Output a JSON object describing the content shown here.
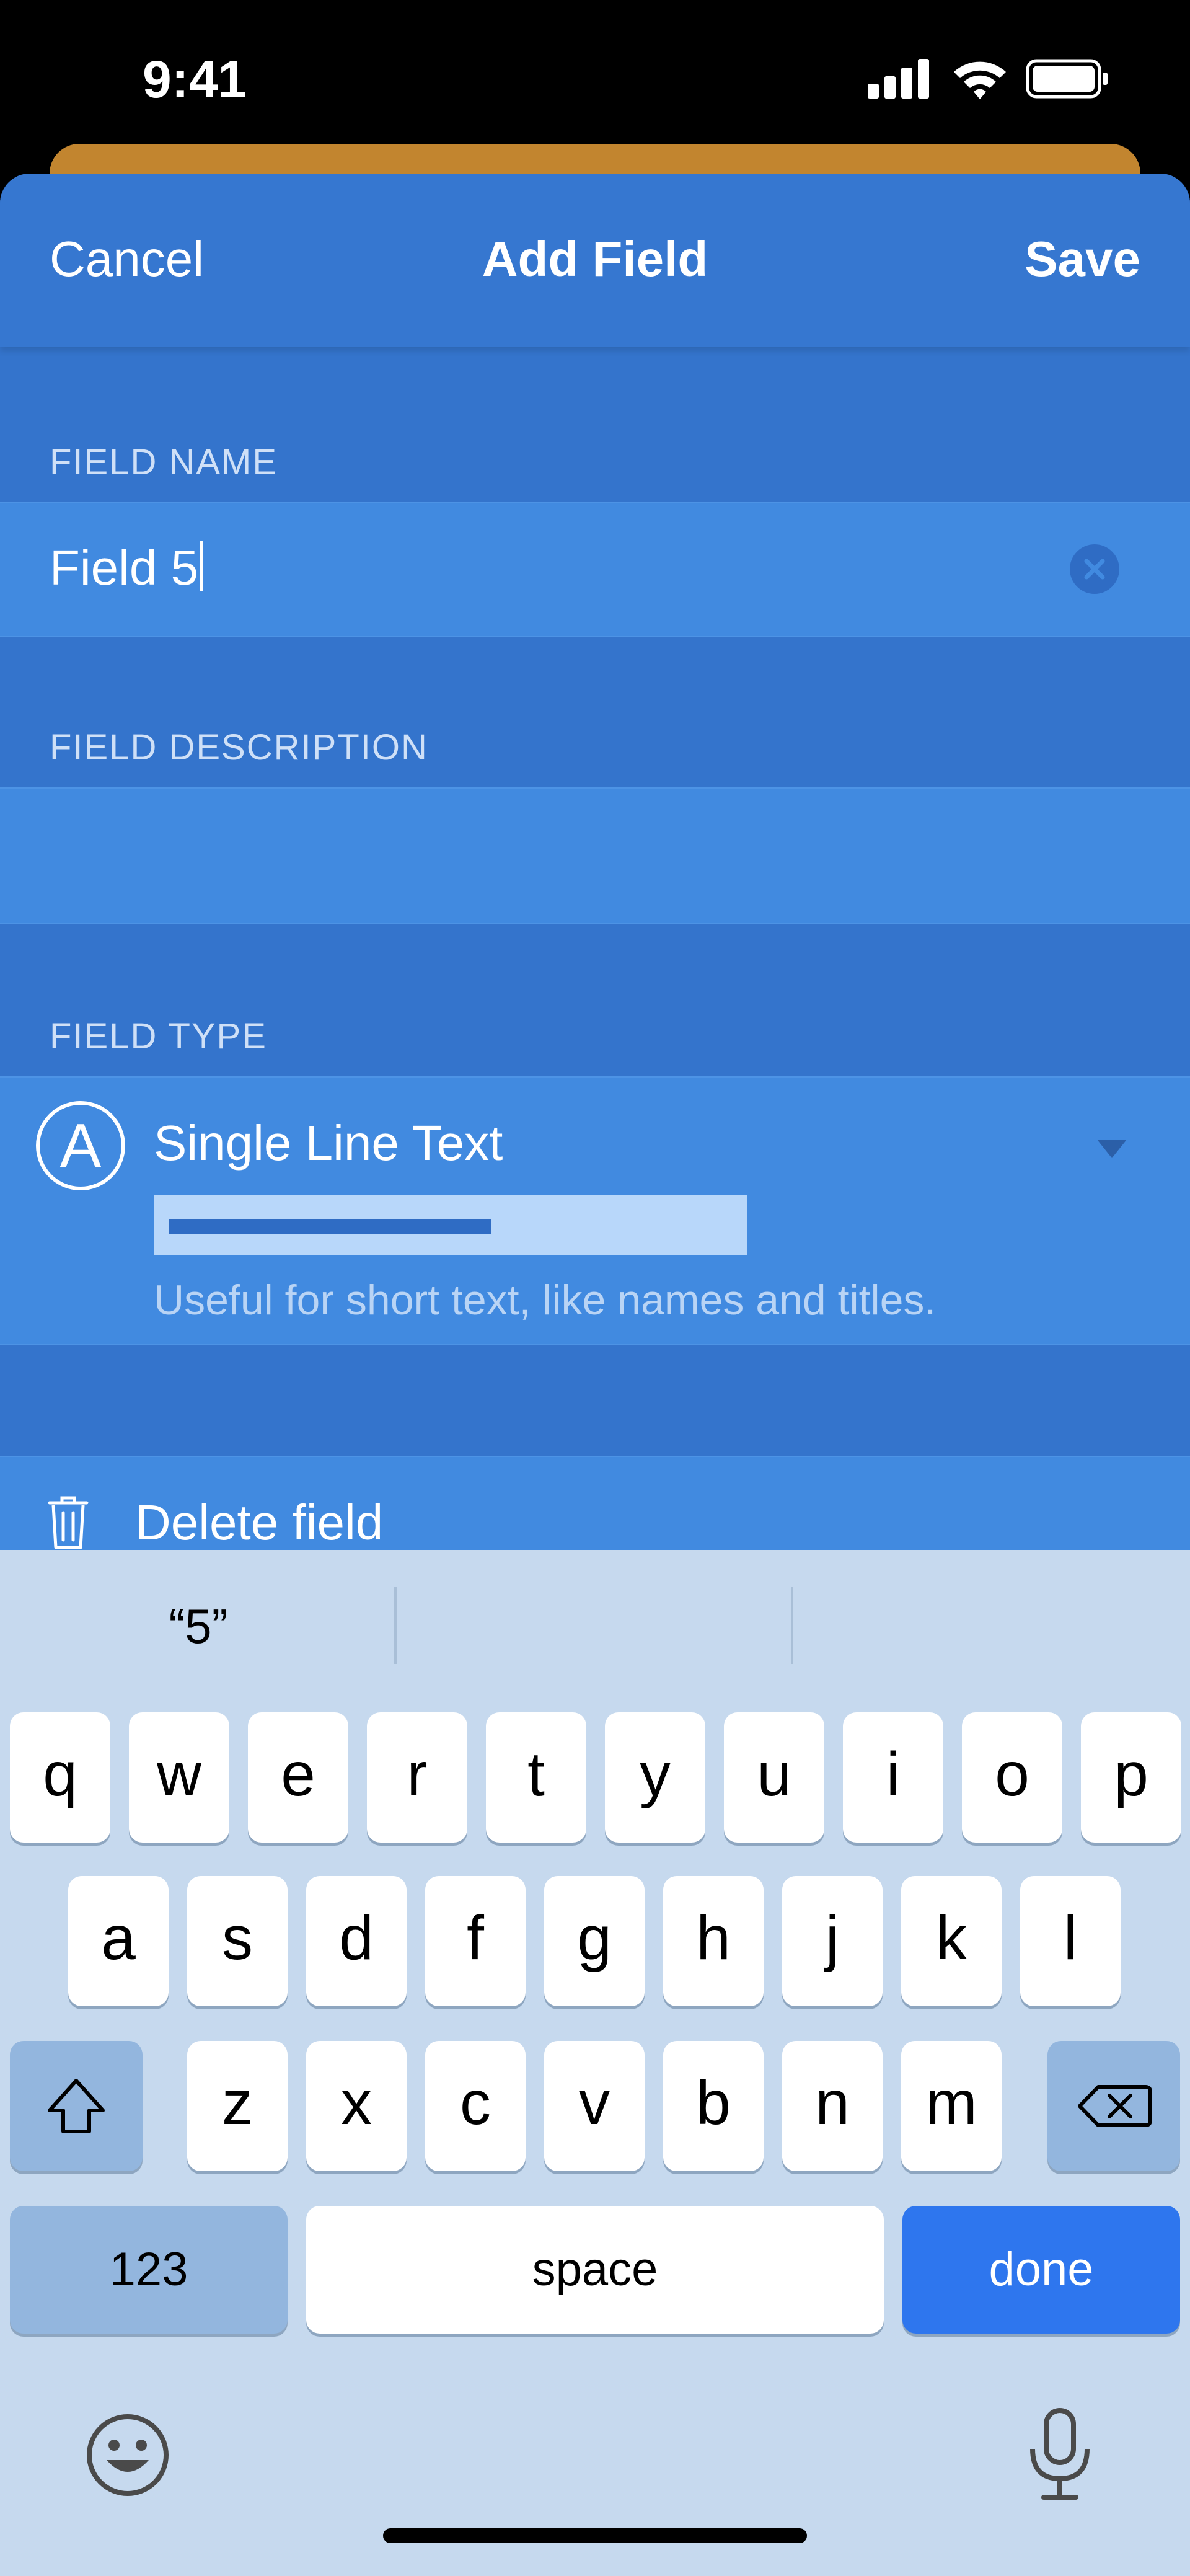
{
  "status_bar": {
    "time": "9:41"
  },
  "navbar": {
    "cancel": "Cancel",
    "title": "Add Field",
    "save": "Save"
  },
  "sections": {
    "field_name": {
      "label": "FIELD NAME",
      "value": "Field 5"
    },
    "field_description": {
      "label": "FIELD DESCRIPTION",
      "value": ""
    },
    "field_type": {
      "label": "FIELD TYPE",
      "icon_letter": "A",
      "type_name": "Single Line Text",
      "description": "Useful for short text, like names and titles."
    }
  },
  "delete": {
    "label": "Delete field"
  },
  "keyboard": {
    "suggestions": [
      "“5”",
      "",
      ""
    ],
    "row1": [
      "q",
      "w",
      "e",
      "r",
      "t",
      "y",
      "u",
      "i",
      "o",
      "p"
    ],
    "row2": [
      "a",
      "s",
      "d",
      "f",
      "g",
      "h",
      "j",
      "k",
      "l"
    ],
    "row3": [
      "z",
      "x",
      "c",
      "v",
      "b",
      "n",
      "m"
    ],
    "numbers": "123",
    "space": "space",
    "done": "done"
  },
  "colors": {
    "accent": "#3474cc",
    "row": "#418ae0",
    "keyboard_bg": "#c6d9ee",
    "done": "#2e76ee",
    "under_sheet": "#c2852f"
  },
  "icons": {
    "signal": "cellular-signal-icon",
    "wifi": "wifi-icon",
    "battery": "battery-icon",
    "clear": "clear-text-icon",
    "type": "letter-a-circle-icon",
    "dropdown": "triangle-down-icon",
    "trash": "trash-icon",
    "shift": "shift-icon",
    "backspace": "backspace-icon",
    "emoji": "emoji-icon",
    "mic": "microphone-icon"
  }
}
